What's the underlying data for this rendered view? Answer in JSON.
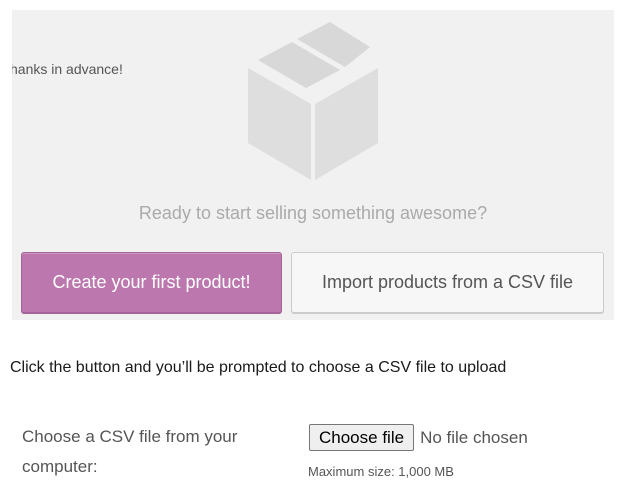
{
  "empty_state": {
    "cutoff_text": "hanks in advance!",
    "tagline": "Ready to start selling something awesome?",
    "box_icon": "box-icon",
    "create_button_label": "Create your first product!",
    "import_button_label": "Import products from a CSV file"
  },
  "instruction": "Click the button and you’ll be prompted to choose a CSV file to upload",
  "upload": {
    "label": "Choose a CSV file from your computer:",
    "choose_button": "Choose file",
    "file_status": "No file chosen",
    "max_size": "Maximum size: 1,000 MB"
  },
  "colors": {
    "accent": "#bb77ae",
    "panel_bg": "#f1f1f1",
    "muted_text": "#aaaaaa"
  }
}
